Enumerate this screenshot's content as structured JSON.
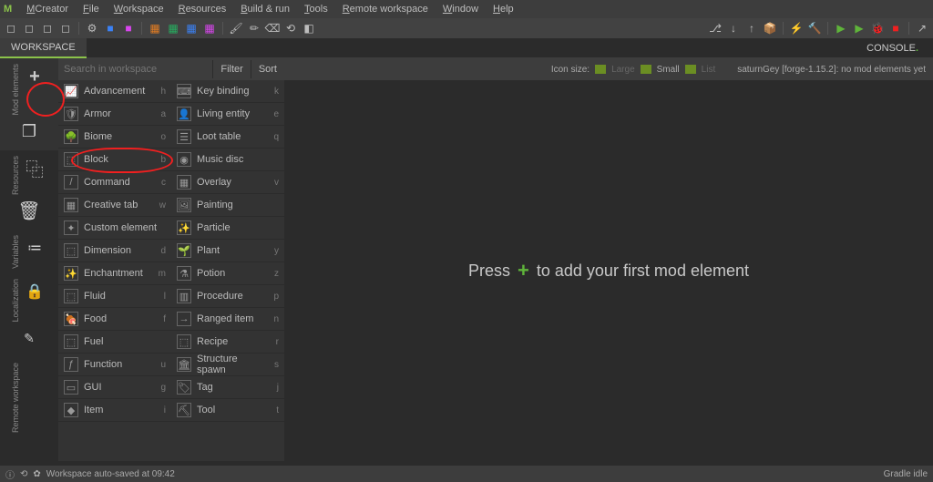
{
  "menubar": {
    "logo": "M",
    "items": [
      {
        "label": "MCreator",
        "ul": "M"
      },
      {
        "label": "File",
        "ul": "F"
      },
      {
        "label": "Workspace",
        "ul": "W"
      },
      {
        "label": "Resources",
        "ul": "R"
      },
      {
        "label": "Build & run",
        "ul": "B"
      },
      {
        "label": "Tools",
        "ul": "T"
      },
      {
        "label": "Remote workspace",
        "ul": "R"
      },
      {
        "label": "Window",
        "ul": "W"
      },
      {
        "label": "Help",
        "ul": "H"
      }
    ]
  },
  "tabs": {
    "workspace": "WORKSPACE",
    "console": "CONSOLE"
  },
  "search": {
    "placeholder": "Search in workspace",
    "filter": "Filter",
    "sort": "Sort"
  },
  "sidetabs": [
    {
      "label": "Mod elements",
      "icon": "plus",
      "active": true
    },
    {
      "label": "Resources",
      "icon": "resources"
    },
    {
      "label": "Variables",
      "icon": "variables"
    },
    {
      "label": "Localization",
      "icon": "localization"
    },
    {
      "label": "Remote workspace",
      "icon": "remote"
    }
  ],
  "side_icons": {
    "copy": "⿻",
    "duplicate": "⿻",
    "delete": "🗑",
    "list": "☰",
    "lock": "🔒",
    "edit": "✎"
  },
  "elements_col1": [
    {
      "label": "Advancement",
      "key": "h",
      "icon": "📈"
    },
    {
      "label": "Armor",
      "key": "a",
      "icon": "🛡"
    },
    {
      "label": "Biome",
      "key": "o",
      "icon": "🌳"
    },
    {
      "label": "Block",
      "key": "b",
      "icon": "⬚"
    },
    {
      "label": "Command",
      "key": "c",
      "icon": "/"
    },
    {
      "label": "Creative tab",
      "key": "w",
      "icon": "▦"
    },
    {
      "label": "Custom element",
      "key": "",
      "icon": "✦"
    },
    {
      "label": "Dimension",
      "key": "d",
      "icon": "⬚"
    },
    {
      "label": "Enchantment",
      "key": "m",
      "icon": "✨"
    },
    {
      "label": "Fluid",
      "key": "l",
      "icon": "⬚"
    },
    {
      "label": "Food",
      "key": "f",
      "icon": "🍖"
    },
    {
      "label": "Fuel",
      "key": "",
      "icon": "⬚"
    },
    {
      "label": "Function",
      "key": "u",
      "icon": "ƒ"
    },
    {
      "label": "GUI",
      "key": "g",
      "icon": "▭"
    },
    {
      "label": "Item",
      "key": "i",
      "icon": "◆"
    }
  ],
  "elements_col2": [
    {
      "label": "Key binding",
      "key": "k",
      "icon": "⌨"
    },
    {
      "label": "Living entity",
      "key": "e",
      "icon": "👤"
    },
    {
      "label": "Loot table",
      "key": "q",
      "icon": "☰"
    },
    {
      "label": "Music disc",
      "key": "",
      "icon": "◉"
    },
    {
      "label": "Overlay",
      "key": "v",
      "icon": "▦"
    },
    {
      "label": "Painting",
      "key": "",
      "icon": "🖼"
    },
    {
      "label": "Particle",
      "key": "",
      "icon": "✨"
    },
    {
      "label": "Plant",
      "key": "y",
      "icon": "🌱"
    },
    {
      "label": "Potion",
      "key": "z",
      "icon": "⚗"
    },
    {
      "label": "Procedure",
      "key": "p",
      "icon": "▥"
    },
    {
      "label": "Ranged item",
      "key": "n",
      "icon": "→"
    },
    {
      "label": "Recipe",
      "key": "r",
      "icon": "⬚"
    },
    {
      "label": "Structure spawn",
      "key": "s",
      "icon": "🏛"
    },
    {
      "label": "Tag",
      "key": "j",
      "icon": "🏷"
    },
    {
      "label": "Tool",
      "key": "t",
      "icon": "⛏"
    }
  ],
  "canvas": {
    "iconsize_label": "Icon size:",
    "large": "Large",
    "small": "Small",
    "list": "List",
    "project": "saturnGey [forge-1.15.2]: no mod elements yet",
    "hint_pre": "Press",
    "hint_post": "to add your first mod element"
  },
  "statusbar": {
    "autosave": "Workspace auto-saved at 09:42",
    "gradle": "Gradle idle"
  }
}
